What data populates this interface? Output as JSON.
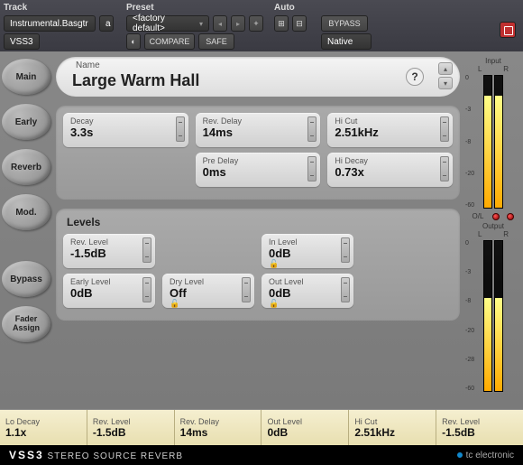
{
  "topbar": {
    "track_label": "Track",
    "track_value": "Instrumental.Basgtr",
    "track_sub": "a",
    "plugin": "VSS3",
    "preset_label": "Preset",
    "preset_value": "<factory default>",
    "compare": "COMPARE",
    "safe": "SAFE",
    "auto_label": "Auto",
    "bypass": "BYPASS",
    "mode": "Native"
  },
  "sidebar": [
    "Main",
    "Early",
    "Reverb",
    "Mod.",
    "Bypass",
    "Fader Assign"
  ],
  "name": {
    "label": "Name",
    "value": "Large Warm Hall"
  },
  "help": "?",
  "params_top": [
    [
      {
        "l": "Decay",
        "v": "3.3s"
      },
      {
        "l": "Rev. Delay",
        "v": "14ms"
      },
      {
        "l": "Hi Cut",
        "v": "2.51kHz"
      }
    ],
    [
      null,
      {
        "l": "Pre Delay",
        "v": "0ms"
      },
      {
        "l": "Hi Decay",
        "v": "0.73x"
      }
    ]
  ],
  "levels_title": "Levels",
  "levels": [
    [
      {
        "l": "Rev. Level",
        "v": "-1.5dB"
      },
      null,
      {
        "l": "In Level",
        "v": "0dB",
        "lock": true
      },
      null
    ],
    [
      {
        "l": "Early Level",
        "v": "0dB"
      },
      {
        "l": "Dry Level",
        "v": "Off",
        "lock": true
      },
      {
        "l": "Out Level",
        "v": "0dB",
        "lock": true
      },
      null
    ]
  ],
  "meters": {
    "input": "Input",
    "output": "Output",
    "L": "L",
    "R": "R",
    "ol": "O/L",
    "scale_in": [
      "0",
      "-3",
      "-8",
      "-20",
      "-60"
    ],
    "scale_out": [
      "0",
      "-3",
      "-8",
      "-20",
      "-28",
      "-60"
    ],
    "in_fill": 85,
    "out_fill": 62
  },
  "footer": [
    {
      "l": "Lo Decay",
      "v": "1.1x"
    },
    {
      "l": "Rev. Level",
      "v": "-1.5dB"
    },
    {
      "l": "Rev. Delay",
      "v": "14ms"
    },
    {
      "l": "Out Level",
      "v": "0dB"
    },
    {
      "l": "Hi Cut",
      "v": "2.51kHz"
    },
    {
      "l": "Rev. Level",
      "v": "-1.5dB"
    }
  ],
  "brand": {
    "name": "VSS3",
    "tag": "STEREO SOURCE REVERB",
    "company": "tc electronic"
  }
}
